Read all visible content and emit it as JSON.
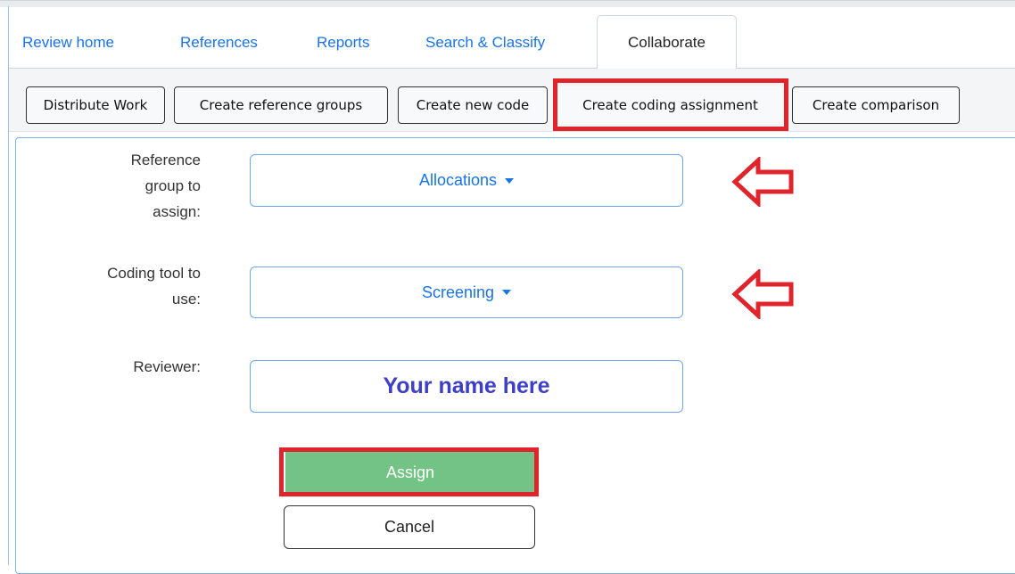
{
  "tabs": [
    {
      "label": "Review home"
    },
    {
      "label": "References"
    },
    {
      "label": "Reports"
    },
    {
      "label": "Search & Classify"
    },
    {
      "label": "Collaborate",
      "active": true
    }
  ],
  "toolbar": {
    "buttons": [
      {
        "label": "Distribute Work"
      },
      {
        "label": "Create reference groups"
      },
      {
        "label": "Create new code"
      },
      {
        "label": "Create coding assignment",
        "highlighted": true
      },
      {
        "label": "Create comparison"
      }
    ]
  },
  "form": {
    "reference_group": {
      "label_lines": [
        "Reference",
        "group to",
        "assign:"
      ],
      "value": "Allocations"
    },
    "coding_tool": {
      "label_lines": [
        "Coding tool to",
        "use:"
      ],
      "value": "Screening"
    },
    "reviewer": {
      "label": "Reviewer:",
      "value": "Your name here"
    },
    "assign_label": "Assign",
    "cancel_label": "Cancel"
  },
  "colors": {
    "link": "#1a73e8",
    "highlight": "#e0242c",
    "assign_button": "#73c386",
    "reviewer_text": "#3d3fc4"
  },
  "icons": [
    "caret-down-icon",
    "left-arrow-annotation-icon"
  ]
}
